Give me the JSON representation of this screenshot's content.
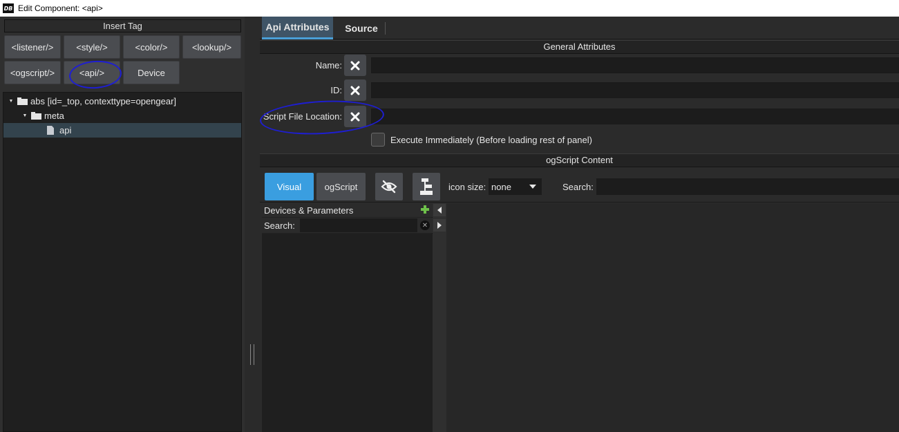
{
  "window": {
    "title": "Edit Component: <api>",
    "logo": "DB"
  },
  "insert_tag": {
    "header": "Insert Tag",
    "buttons": [
      "<listener/>",
      "<style/>",
      "<color/>",
      "<lookup/>",
      "<ogscript/>",
      "<api/>",
      "Device"
    ]
  },
  "tree": {
    "items": [
      {
        "label": "abs [id=_top, contexttype=opengear]",
        "type": "folder",
        "expanded": true
      },
      {
        "label": "meta",
        "type": "folder",
        "expanded": true
      },
      {
        "label": "api",
        "type": "file",
        "selected": true
      }
    ]
  },
  "tabs": [
    "Api Attributes",
    "Source"
  ],
  "general": {
    "header": "General Attributes",
    "fields": [
      {
        "label": "Name:",
        "value": ""
      },
      {
        "label": "ID:",
        "value": ""
      },
      {
        "label": "Script File Location:",
        "value": ""
      }
    ],
    "checkbox_label": "Execute Immediately (Before loading rest of panel)",
    "checkbox_checked": false
  },
  "ogscript": {
    "header": "ogScript Content",
    "visual_label": "Visual",
    "ogscript_label": "ogScript",
    "icon_size_label": "icon size:",
    "icon_size_value": "none",
    "search_label": "Search:",
    "search_value": ""
  },
  "devices": {
    "header": "Devices & Parameters",
    "search_label": "Search:",
    "search_value": ""
  },
  "colors": {
    "accent": "#3a9ee0",
    "tab_active": "#3f5466",
    "annotation": "#1e1ed2"
  }
}
